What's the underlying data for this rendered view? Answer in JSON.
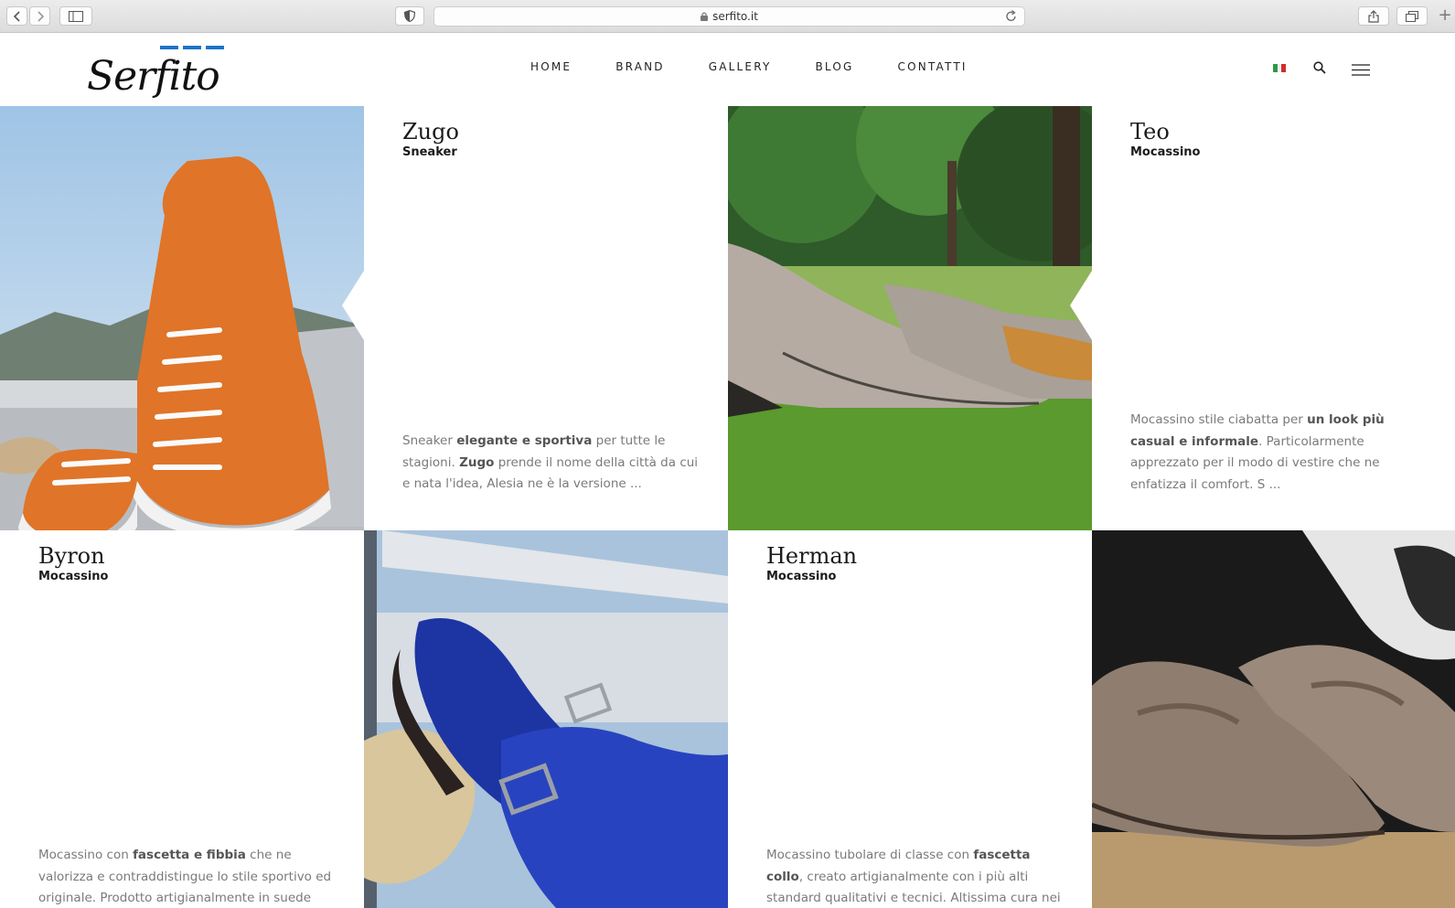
{
  "browser": {
    "url": "serfito.it"
  },
  "header": {
    "logo_text": "Serfito",
    "nav": [
      "HOME",
      "BRAND",
      "GALLERY",
      "BLOG",
      "CONTATTI"
    ],
    "colors": {
      "accent": "#1a73c9",
      "text": "#222222"
    }
  },
  "products": [
    {
      "name": "Zugo",
      "category": "Sneaker",
      "description_parts": [
        {
          "t": "Sneaker ",
          "b": false
        },
        {
          "t": "elegante e sportiva",
          "b": true
        },
        {
          "t": " per tutte le stagioni. ",
          "b": false
        },
        {
          "t": "Zugo",
          "b": true
        },
        {
          "t": " prende il nome della città da cui e nata l'idea, Alesia ne è la versione ...",
          "b": false
        }
      ]
    },
    {
      "name": "Teo",
      "category": "Mocassino",
      "description_parts": [
        {
          "t": "Mocassino stile ciabatta per ",
          "b": false
        },
        {
          "t": "un look più casual e informale",
          "b": true
        },
        {
          "t": ". Particolarmente apprezzato per il modo di vestire che ne enfatizza il comfort. S ...",
          "b": false
        }
      ]
    },
    {
      "name": "Byron",
      "category": "Mocassino",
      "description_parts": [
        {
          "t": "Mocassino con ",
          "b": false
        },
        {
          "t": "fascetta e fibbia",
          "b": true
        },
        {
          "t": " che ne valorizza e contraddistingue lo stile sportivo ed originale. Prodotto artigianalmente in suede",
          "b": false
        }
      ]
    },
    {
      "name": "Herman",
      "category": "Mocassino",
      "description_parts": [
        {
          "t": "Mocassino tubolare di classe con ",
          "b": false
        },
        {
          "t": "fascetta collo",
          "b": true
        },
        {
          "t": ", creato artigianalmente con i più alti standard qualitativi e tecnici. Altissima cura nei",
          "b": false
        }
      ]
    }
  ],
  "photos": [
    {
      "alt": "orange suede sneaker on a boat deck",
      "color": "#e0742a"
    },
    {
      "alt": "grey suede loafers on grass",
      "color": "#b4aaa2"
    },
    {
      "alt": "blue suede loafer with buckle on a boat",
      "color": "#2238a6"
    },
    {
      "alt": "brown suede penny loafers",
      "color": "#8f7f72"
    }
  ]
}
